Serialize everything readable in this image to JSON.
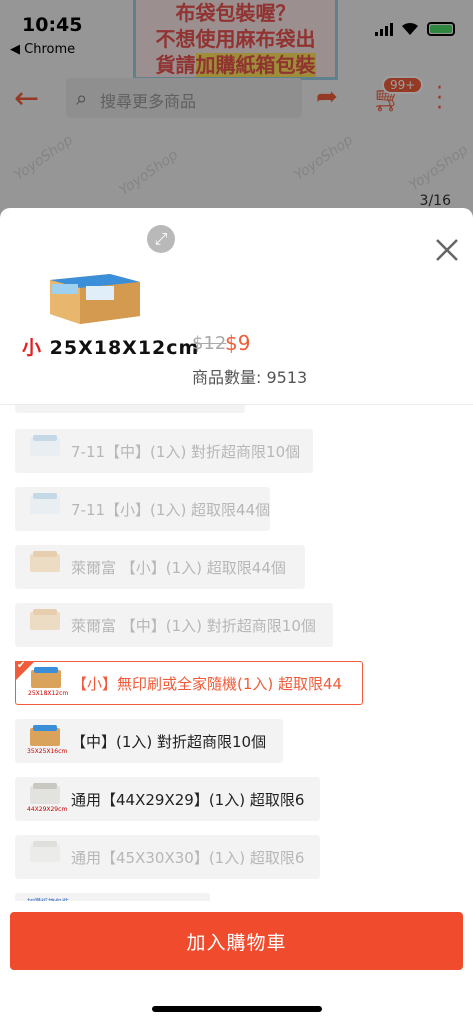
{
  "status_bar": {
    "time": "10:45",
    "back_app": "◀ Chrome"
  },
  "banner": {
    "line1": "布袋包裝喔？",
    "line2": "不想使用麻布袋出",
    "line3_a": "貨請",
    "line3_b": "加購紙箱包裝"
  },
  "header": {
    "search_placeholder": "搜尋更多商品",
    "cart_badge": "99+"
  },
  "image_counter": "3/16",
  "watermark": "YoyoShop",
  "product": {
    "size_prefix": "小",
    "size_text": "25X18X12cm",
    "price_original": "$12",
    "price_current": "$9",
    "quantity_label": "商品數量: ",
    "quantity_value": "9513"
  },
  "options": [
    {
      "label": "7-11【中】(1入) 對折超商限10個",
      "state": "disabled",
      "thumb": "box-white-blue"
    },
    {
      "label": "7-11【小】(1入) 超取限44個",
      "state": "disabled",
      "thumb": "box-white-blue"
    },
    {
      "label": "萊爾富 【小】(1入) 超取限44個",
      "state": "disabled",
      "thumb": "box-kraft"
    },
    {
      "label": "萊爾富 【中】(1入) 對折超商限10個",
      "state": "disabled",
      "thumb": "box-kraft"
    },
    {
      "label": "【小】無印刷或全家隨機(1入) 超取限44",
      "state": "selected",
      "thumb": "box-blue-yellow",
      "thumb_text": "25X18X12cm"
    },
    {
      "label": "【中】(1入) 對折超商限10個",
      "state": "normal",
      "thumb": "box-blue-yellow",
      "thumb_text": "35X25X16cm"
    },
    {
      "label": "通用【44X29X29】(1入) 超取限6",
      "state": "normal",
      "thumb": "box-grey",
      "thumb_text": "44X29X29cm"
    },
    {
      "label": "通用【45X30X30】(1入) 超取限6",
      "state": "disabled",
      "thumb": "box-grey"
    }
  ],
  "partial_option_text": "加購紙箱包裝",
  "add_to_cart_label": "加入購物車",
  "colors": {
    "accent": "#f05c3a",
    "button": "#f04b2d",
    "disabled_text": "#b7b7b7"
  }
}
